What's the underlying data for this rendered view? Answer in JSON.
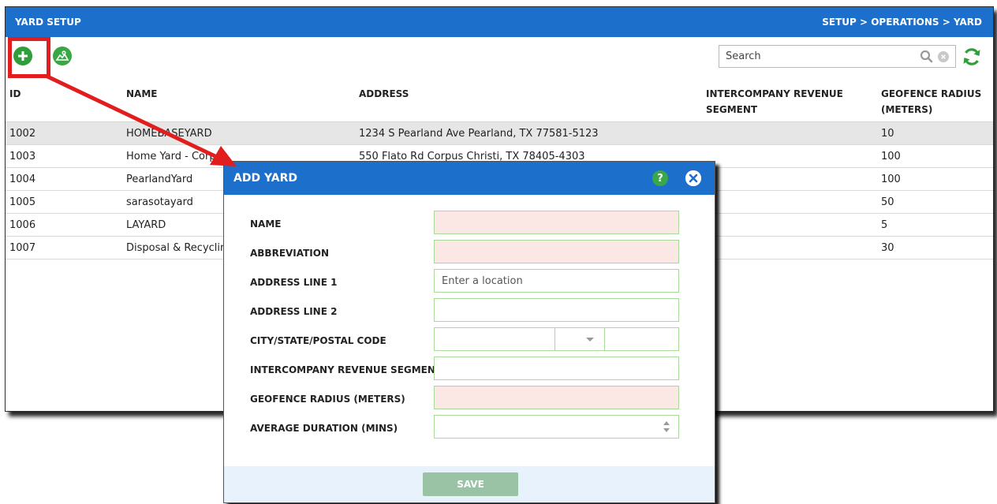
{
  "window": {
    "title": "YARD SETUP",
    "breadcrumb": "SETUP > OPERATIONS > YARD"
  },
  "toolbar": {
    "add_icon": "plus-circle-icon",
    "map_icon": "map-pin-icon",
    "search_placeholder": "Search",
    "refresh_icon": "refresh-icon"
  },
  "table": {
    "headers": {
      "id": "ID",
      "name": "NAME",
      "address": "ADDRESS",
      "segment_line1": "INTERCOMPANY REVENUE",
      "segment_line2": "SEGMENT",
      "geofence_line1": "GEOFENCE RADIUS",
      "geofence_line2": "(METERS)"
    },
    "rows": [
      {
        "id": "1002",
        "name": "HOMEBASEYARD",
        "address": "1234 S Pearland Ave Pearland, TX 77581-5123",
        "segment": "",
        "geofence": "10"
      },
      {
        "id": "1003",
        "name": "Home Yard - Corpus",
        "address": "550 Flato Rd Corpus Christi, TX 78405-4303",
        "segment": "",
        "geofence": "100"
      },
      {
        "id": "1004",
        "name": "PearlandYard",
        "address": "",
        "segment": "",
        "geofence": "100"
      },
      {
        "id": "1005",
        "name": "sarasotayard",
        "address": "",
        "segment": "",
        "geofence": "50"
      },
      {
        "id": "1006",
        "name": "LAYARD",
        "address": "",
        "segment": "",
        "geofence": "5"
      },
      {
        "id": "1007",
        "name": "Disposal & Recyclin",
        "address": "",
        "segment": "",
        "geofence": "30"
      }
    ]
  },
  "dialog": {
    "title": "ADD YARD",
    "help_glyph": "?",
    "fields": {
      "name": "NAME",
      "abbreviation": "ABBREVIATION",
      "address1": "ADDRESS LINE 1",
      "address1_placeholder": "Enter a location",
      "address2": "ADDRESS LINE 2",
      "city_state_postal": "CITY/STATE/POSTAL CODE",
      "segment": "INTERCOMPANY REVENUE SEGMENT",
      "geofence": "GEOFENCE RADIUS (METERS)",
      "duration": "AVERAGE DURATION (MINS)"
    },
    "save_label": "SAVE"
  },
  "colors": {
    "header_blue": "#1d6fcc",
    "accent_green": "#3aa745",
    "required_field": "#fbe8e5",
    "callout_red": "#e11d1d"
  }
}
